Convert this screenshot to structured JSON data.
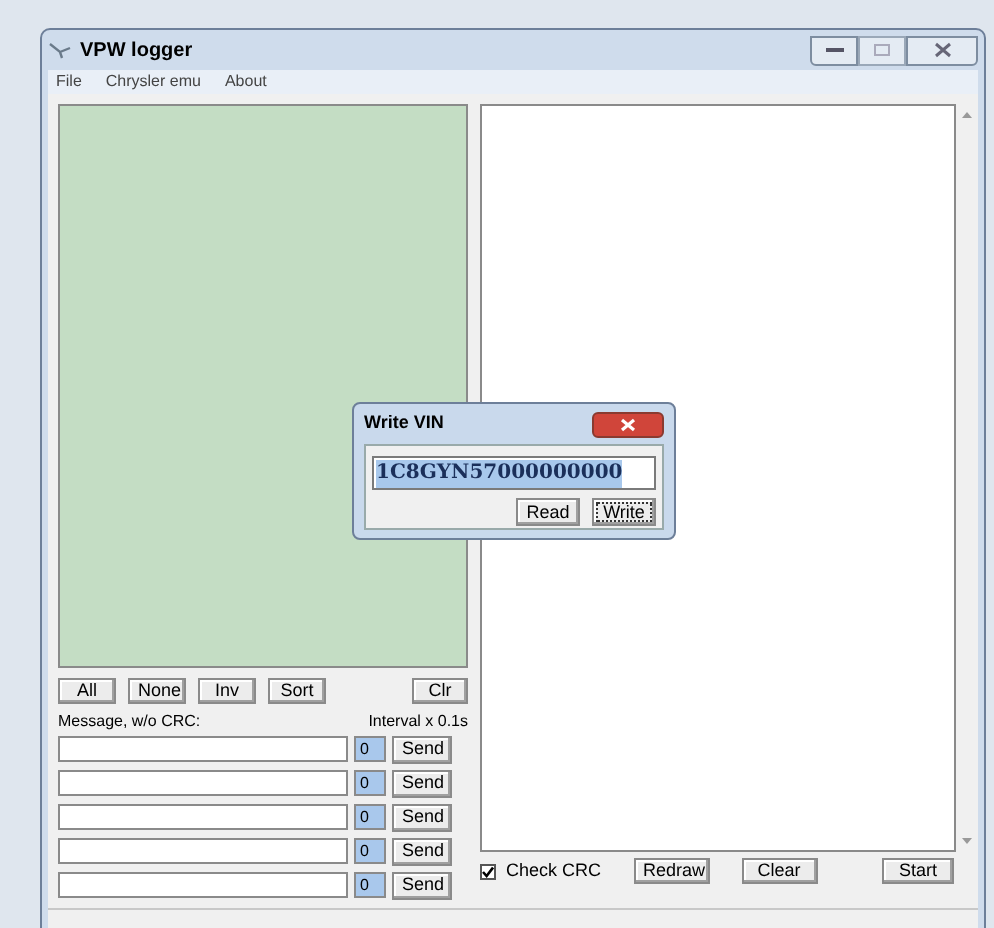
{
  "window": {
    "title": "VPW logger"
  },
  "menu": [
    {
      "label": "File"
    },
    {
      "label": "Chrysler emu"
    },
    {
      "label": "About"
    }
  ],
  "list_buttons": [
    "All",
    "None",
    "Inv",
    "Sort",
    "Clr"
  ],
  "message_label": "Message, w/o CRC:",
  "interval_label": "Interval x 0.1s",
  "messages": [
    {
      "interval": "0",
      "send": "Send"
    },
    {
      "interval": "0",
      "send": "Send"
    },
    {
      "interval": "0",
      "send": "Send"
    },
    {
      "interval": "0",
      "send": "Send"
    },
    {
      "interval": "0",
      "send": "Send"
    }
  ],
  "check_crc": {
    "label": "Check CRC",
    "checked": true
  },
  "actions": [
    "Redraw",
    "Clear"
  ],
  "start": "Start",
  "dialog": {
    "title": "Write VIN",
    "vin": "1C8GYN57000000000",
    "buttons": [
      {
        "label": "Read",
        "focused": false
      },
      {
        "label": "Write",
        "focused": true
      }
    ]
  }
}
